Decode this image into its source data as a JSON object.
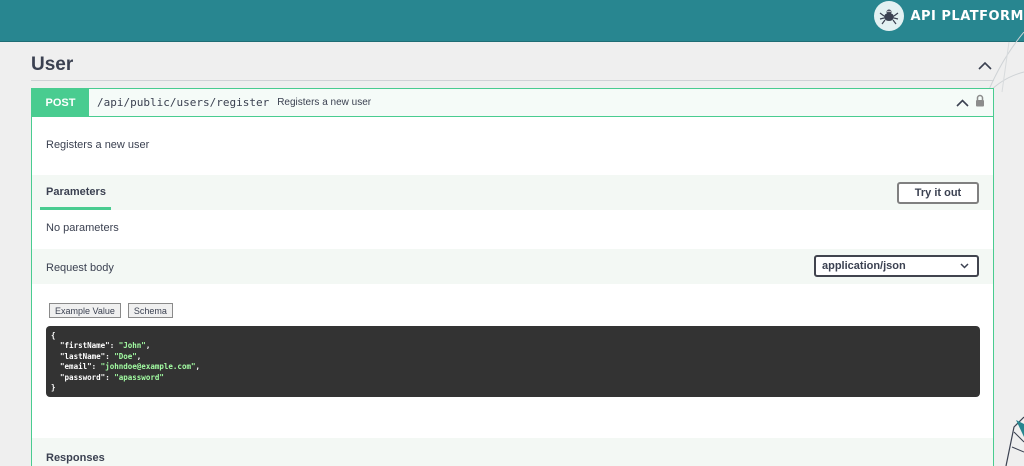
{
  "brand": {
    "name": "API PLATFORM"
  },
  "section": {
    "title": "User"
  },
  "operation": {
    "method": "POST",
    "path": "/api/public/users/register",
    "summary": "Registers a new user",
    "description": "Registers a new user"
  },
  "parameters": {
    "tab_label": "Parameters",
    "try_label": "Try it out",
    "empty_text": "No parameters"
  },
  "request_body": {
    "label": "Request body",
    "content_type": "application/json",
    "tabs": [
      "Example Value",
      "Schema"
    ],
    "example": {
      "open": "{",
      "close": "}",
      "fields": [
        {
          "key": "\"firstName\"",
          "value": "\"John\"",
          "sep": ","
        },
        {
          "key": "\"lastName\"",
          "value": "\"Doe\"",
          "sep": ","
        },
        {
          "key": "\"email\"",
          "value": "\"johndoe@example.com\"",
          "sep": ","
        },
        {
          "key": "\"password\"",
          "value": "\"apassword\"",
          "sep": ""
        }
      ]
    }
  },
  "responses": {
    "title": "Responses"
  },
  "colors": {
    "topbar": "#288690",
    "post": "#49cc90",
    "code_bg": "#333333",
    "code_string": "#a2fca2"
  }
}
